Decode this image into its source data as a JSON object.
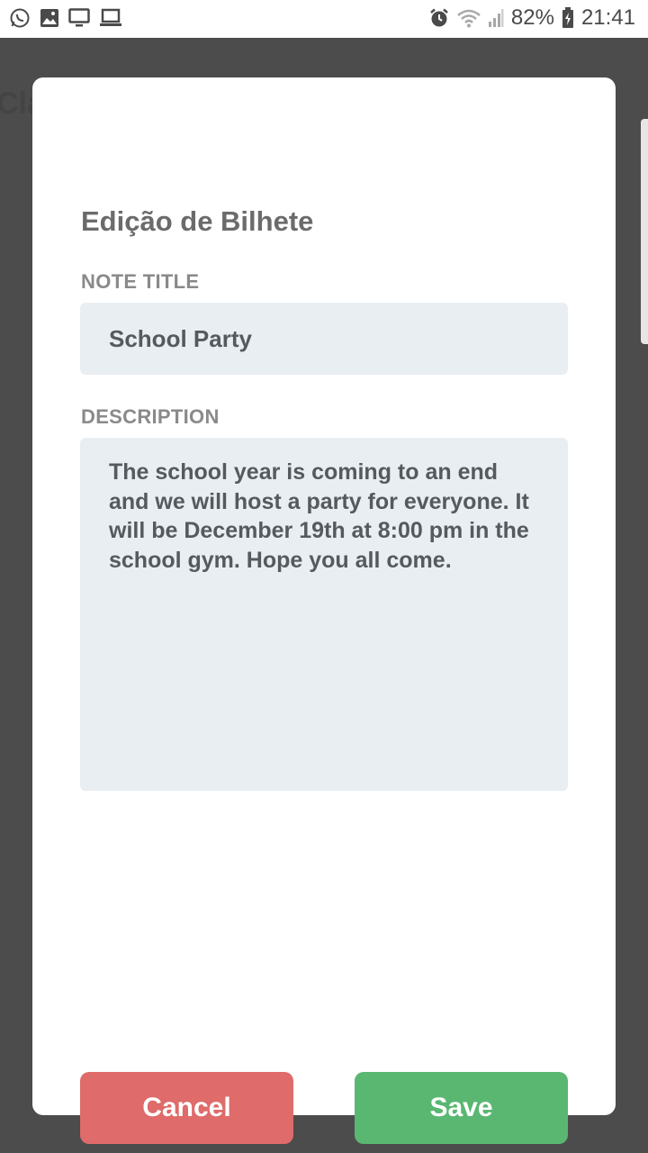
{
  "status_bar": {
    "battery": "82%",
    "time": "21:41",
    "left_icons": [
      "whatsapp-icon",
      "image-icon",
      "monitor-icon",
      "laptop-icon"
    ],
    "right_icons": [
      "alarm-icon",
      "wifi-icon",
      "signal-icon",
      "battery-icon"
    ]
  },
  "background": {
    "partial_text": "Cla"
  },
  "dialog": {
    "title": "Edição de Bilhete",
    "note_title_label": "NOTE TITLE",
    "note_title_value": "School Party",
    "description_label": "DESCRIPTION",
    "description_value": "The school year is coming to an end and we will host a party for everyone. It will be December 19th at 8:00 pm in the school gym. Hope you all come.",
    "cancel_label": "Cancel",
    "save_label": "Save"
  },
  "colors": {
    "overlay": "#4c4c4c",
    "field_bg": "#e9eef3",
    "cancel": "#df6b6b",
    "save": "#5ab772",
    "title_text": "#6b6b6b",
    "label_text": "#8a8a8a"
  }
}
